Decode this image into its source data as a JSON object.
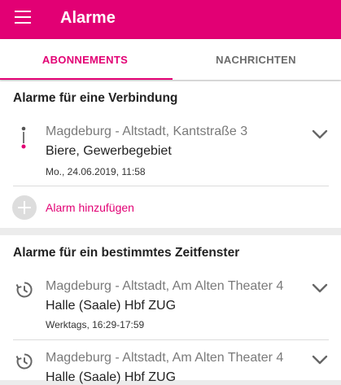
{
  "appbar": {
    "title": "Alarme",
    "menu_icon": "hamburger-menu-icon",
    "color": "#e20074"
  },
  "tabs": [
    {
      "label": "ABONNEMENTS",
      "active": true
    },
    {
      "label": "NACHRICHTEN",
      "active": false
    }
  ],
  "section_connection": {
    "title": "Alarme für eine Verbindung",
    "items": [
      {
        "icon": "connection-route-icon",
        "from": "Magdeburg - Altstadt, Kantstraße 3",
        "to": "Biere, Gewerbegebiet",
        "time": "Mo., 24.06.2019, 11:58"
      }
    ],
    "add_label": "Alarm hinzufügen"
  },
  "section_timewindow": {
    "title": "Alarme für ein bestimmtes Zeitfenster",
    "items": [
      {
        "icon": "recurring-clock-icon",
        "from": "Magdeburg - Altstadt, Am Alten Theater 4",
        "to": "Halle (Saale) Hbf ZUG",
        "time": "Werktags, 16:29-17:59"
      },
      {
        "icon": "recurring-clock-icon",
        "from": "Magdeburg - Altstadt, Am Alten Theater 4",
        "to": "Halle (Saale) Hbf ZUG"
      }
    ]
  }
}
